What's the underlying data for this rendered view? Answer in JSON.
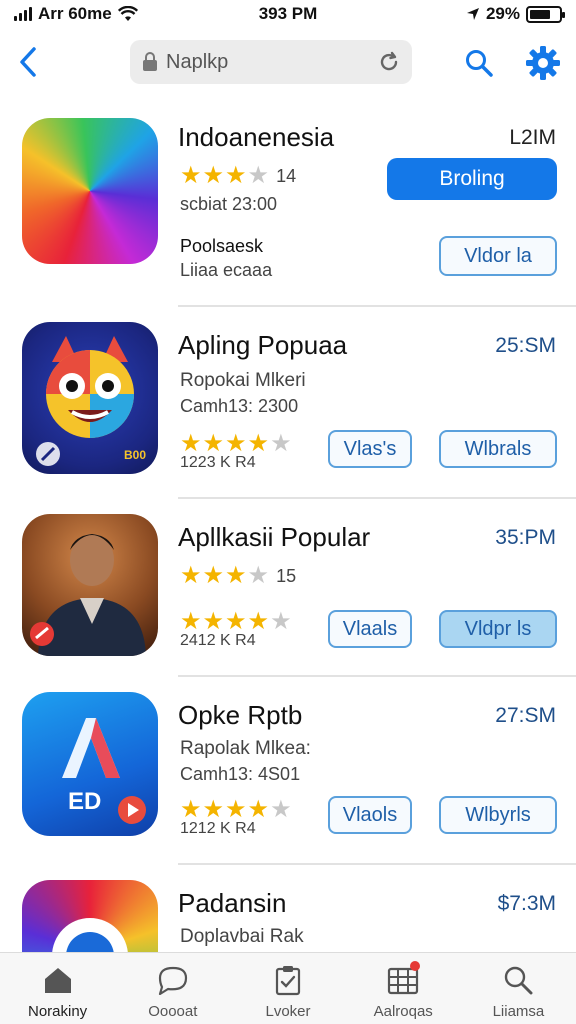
{
  "status": {
    "carrier": "Arr 60me",
    "time": "393 PM",
    "battery": "29%"
  },
  "nav": {
    "search_value": "Naplkp",
    "icons": {
      "back": "chevron-left-icon",
      "search": "search-icon",
      "settings": "gear-icon",
      "lock": "lock-icon",
      "reload": "reload-icon"
    }
  },
  "apps": [
    {
      "name": "Indoanenesia",
      "size": "L2IM",
      "rating_count": "14",
      "line1": "scbiat 23:00",
      "line2a": "Poolsaesk",
      "line2b": "Liiaa ecaaa",
      "primary_label": "Broling",
      "outline_label": "Vldor la"
    },
    {
      "name": "Apling Popuaa",
      "size": "25:SM",
      "line1": "Ropokai Mlkeri",
      "line2": "Camh13: 2300",
      "rating_count": "1223 K R4",
      "btn1": "Vlas's",
      "btn2": "Wlbrals",
      "badge_text": "B00"
    },
    {
      "name": "Apllkasii Popular",
      "size": "35:PM",
      "rating_count_top": "15",
      "rating_count": "2412 K R4",
      "btn1": "Vlaals",
      "btn2": "Vldpr ls"
    },
    {
      "name": "Opke Rptb",
      "size": "27:SM",
      "line1": "Rapolak Mlkea:",
      "line2": "Camh13: 4S01",
      "rating_count": "1212 K R4",
      "btn1": "Vlaols",
      "btn2": "Wlbyrls",
      "icon_text": "ED"
    },
    {
      "name": "Padansin",
      "size": "$7:3M",
      "line1": "Doplavbai Rak"
    }
  ],
  "tabs": [
    {
      "label": "Norakiny",
      "icon": "home-icon"
    },
    {
      "label": "Ooooat",
      "icon": "chat-icon"
    },
    {
      "label": "Lvoker",
      "icon": "clipboard-icon"
    },
    {
      "label": "Aalroqas",
      "icon": "grid-icon"
    },
    {
      "label": "Liiamsa",
      "icon": "search-icon"
    }
  ],
  "colors": {
    "accent": "#1478e8",
    "star": "#f4b400",
    "outline": "#5aa0dc"
  }
}
